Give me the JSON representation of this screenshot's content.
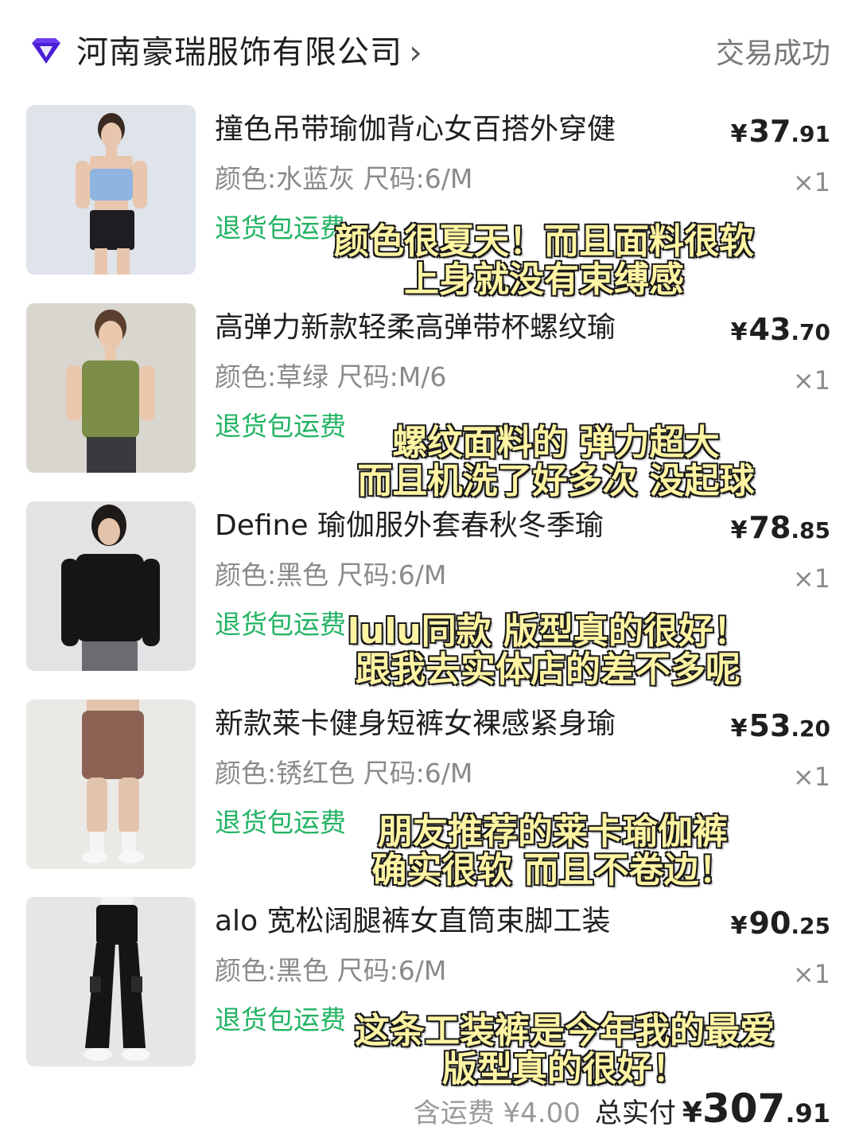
{
  "shop": {
    "name": "河南豪瑞服饰有限公司",
    "chevron": "›",
    "status": "交易成功",
    "logo_icon": "diamond-logo-icon",
    "logo_color": "#4a1fd6"
  },
  "products": [
    {
      "title": "撞色吊带瑜伽背心女百搭外穿健",
      "spec": "颜色:水蓝灰 尺码:6/M",
      "badge": "退货包运费",
      "price_currency": "¥",
      "price_int": "37",
      "price_dec": ".91",
      "qty": "×1",
      "caption": [
        "颜色很夏天！而且面料很软",
        "上身就没有束缚感"
      ]
    },
    {
      "title": "高弹力新款轻柔高弹带杯螺纹瑜",
      "spec": "颜色:草绿 尺码:M/6",
      "badge": "退货包运费",
      "price_currency": "¥",
      "price_int": "43",
      "price_dec": ".70",
      "qty": "×1",
      "caption": [
        "螺纹面料的 弹力超大",
        "而且机洗了好多次 没起球"
      ]
    },
    {
      "title": "Define 瑜伽服外套春秋冬季瑜",
      "spec": "颜色:黑色 尺码:6/M",
      "badge": "退货包运费",
      "price_currency": "¥",
      "price_int": "78",
      "price_dec": ".85",
      "qty": "×1",
      "caption": [
        "lulu同款 版型真的很好！",
        "跟我去实体店的差不多呢"
      ]
    },
    {
      "title": "新款莱卡健身短裤女裸感紧身瑜",
      "spec": "颜色:锈红色 尺码:6/M",
      "badge": "退货包运费",
      "price_currency": "¥",
      "price_int": "53",
      "price_dec": ".20",
      "qty": "×1",
      "caption": [
        "朋友推荐的莱卡瑜伽裤",
        "确实很软 而且不卷边！"
      ]
    },
    {
      "title": "alo 宽松阔腿裤女直筒束脚工装",
      "spec": "颜色:黑色 尺码:6/M",
      "badge": "退货包运费",
      "price_currency": "¥",
      "price_int": "90",
      "price_dec": ".25",
      "qty": "×1",
      "caption": [
        "这条工装裤是今年我的最爱",
        "版型真的很好！"
      ]
    }
  ],
  "summary": {
    "shipping": "含运费 ¥4.00",
    "total_label": "总实付",
    "total_currency": "¥",
    "total_int": "307",
    "total_dec": ".91"
  }
}
